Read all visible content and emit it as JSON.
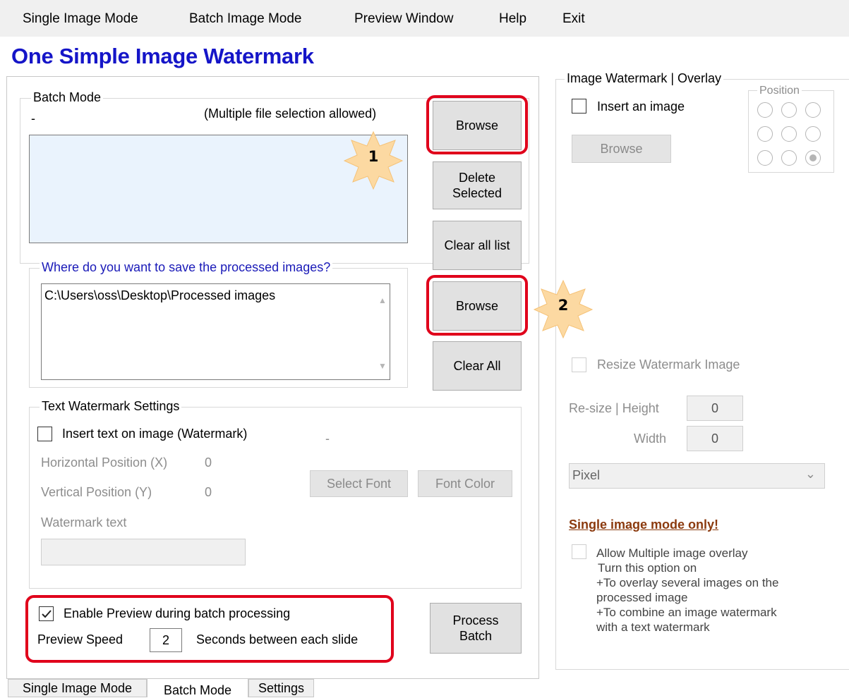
{
  "menu": {
    "items": [
      "Single Image Mode",
      "Batch Image Mode",
      "Preview Window",
      "Help",
      "Exit"
    ]
  },
  "app_title": "One Simple Image Watermark",
  "batch_mode": {
    "group_label": "Batch Mode",
    "dash": "-",
    "multi_note": "(Multiple file selection allowed)",
    "browse_label": "Browse",
    "delete_selected_lines": [
      "Delete",
      "Selected"
    ],
    "clear_list_label": "Clear all list"
  },
  "save_location": {
    "group_label": "Where do you want to save the processed images?",
    "path": "C:\\Users\\oss\\Desktop\\Processed images",
    "browse_label": "Browse",
    "clear_all_label": "Clear All"
  },
  "text_watermark": {
    "group_label": "Text Watermark Settings",
    "insert_label": "Insert text on image (Watermark)",
    "dash": "-",
    "h_pos_label": "Horizontal Position (X)",
    "h_pos_value": "0",
    "v_pos_label": "Vertical Position (Y)",
    "v_pos_value": "0",
    "select_font_label": "Select Font",
    "font_color_label": "Font Color",
    "text_label": "Watermark text",
    "text_value": ""
  },
  "preview": {
    "enable_label": "Enable Preview during batch processing",
    "enabled": true,
    "speed_label": "Preview Speed",
    "speed_value": "2",
    "speed_unit": "Seconds between each slide",
    "process_batch_lines": [
      "Process",
      "Batch"
    ]
  },
  "image_watermark": {
    "group_label": "Image Watermark | Overlay",
    "insert_label": "Insert an image",
    "browse_label": "Browse",
    "position_label": "Position",
    "position_selected_index": 8,
    "resize_label": "Resize Watermark Image",
    "resize_height_label": "Re-size | Height",
    "resize_height_value": "0",
    "resize_width_label": "Width",
    "resize_width_value": "0",
    "unit_value": "Pixel",
    "single_mode_heading": "Single image mode only!",
    "multi_overlay_label": "Allow Multiple image overlay",
    "multi_overlay_desc": [
      "Turn this option on",
      "+To overlay several images on the",
      "processed image",
      "+To combine an image watermark",
      "with a text watermark"
    ]
  },
  "callouts": {
    "first": "1",
    "second": "2"
  },
  "tabs": [
    "Single Image Mode",
    "Batch Mode",
    "Settings"
  ],
  "active_tab_index": 1,
  "colors": {
    "title": "#1515c8",
    "highlight": "#e0001b",
    "list_bg": "#eaf3fd",
    "single_mode_heading": "#8b3a0e",
    "save_group_label": "#1a1ab8",
    "badge_fill": "#fcd9a2"
  }
}
